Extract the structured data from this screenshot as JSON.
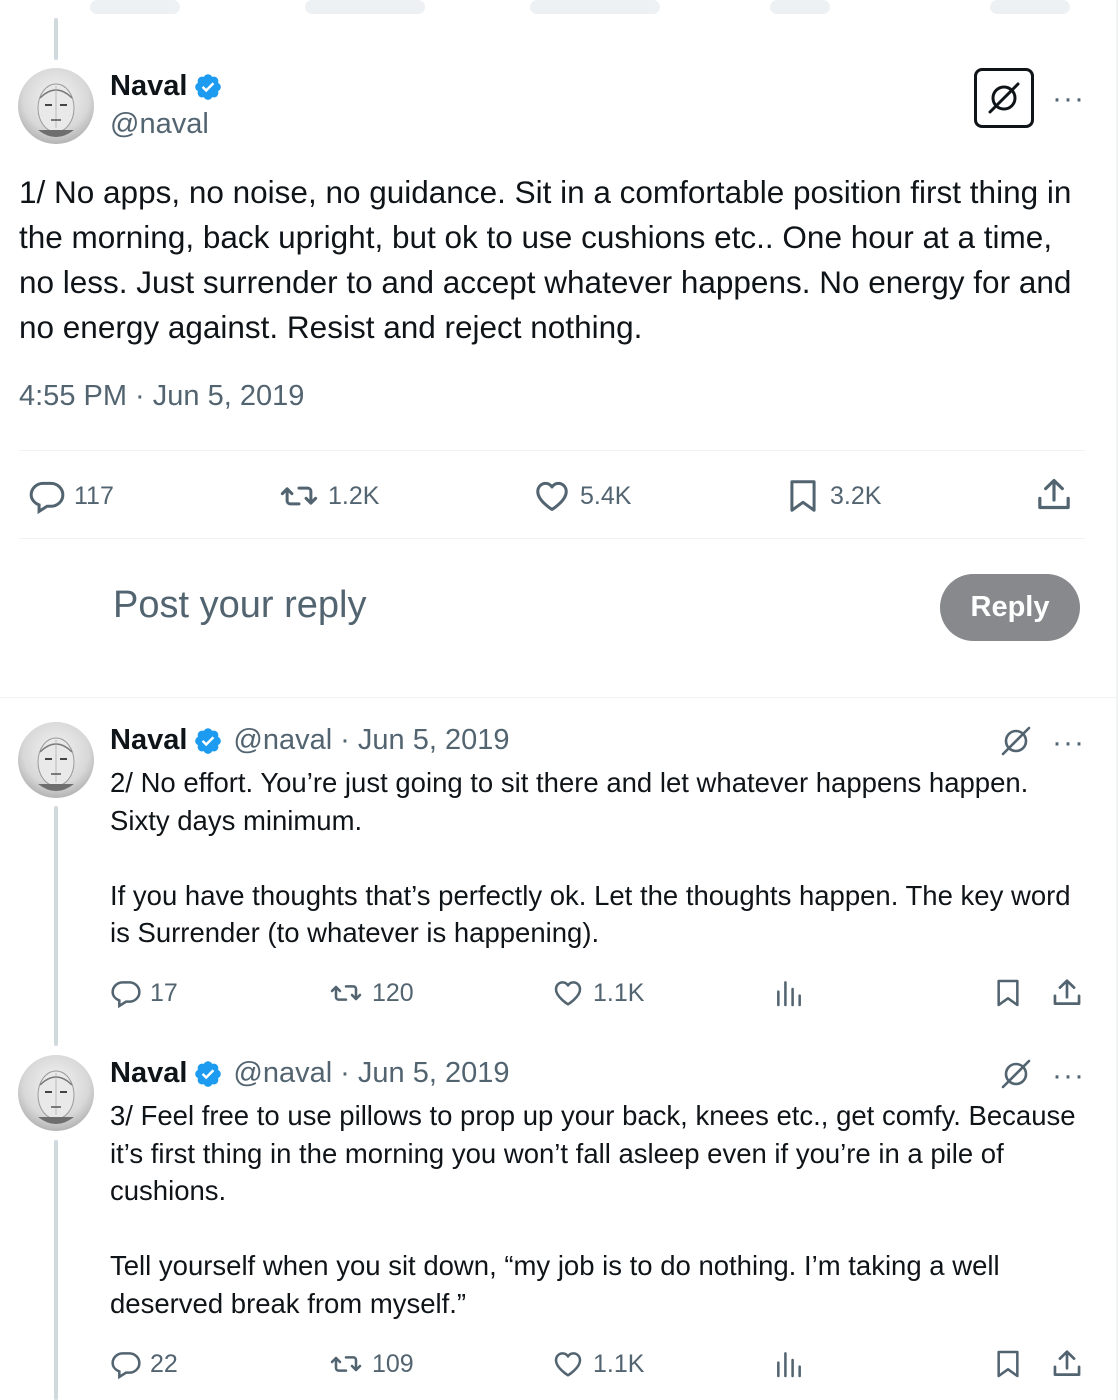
{
  "main_tweet": {
    "name": "Naval",
    "handle": "@naval",
    "text": "1/ No apps, no noise, no guidance. Sit in a comfortable position first thing in the morning, back upright, but ok to use cushions etc.. One hour at a time, no less. Just surrender to and accept whatever happens. No energy for and no energy against. Resist and reject nothing.",
    "timestamp": "4:55 PM · Jun 5, 2019",
    "replies": "117",
    "reposts": "1.2K",
    "likes": "5.4K",
    "bookmarks": "3.2K"
  },
  "composer": {
    "placeholder": "Post your reply",
    "reply_button": "Reply"
  },
  "thread": [
    {
      "name": "Naval",
      "handle": "@naval",
      "date": "· Jun 5, 2019",
      "paragraphs": [
        "2/ No effort. You’re just going to sit there and let whatever happens happen. Sixty days minimum.",
        "If you have thoughts that’s perfectly ok. Let the thoughts happen. The key word is Surrender (to whatever is happening)."
      ],
      "replies": "17",
      "reposts": "120",
      "likes": "1.1K"
    },
    {
      "name": "Naval",
      "handle": "@naval",
      "date": "· Jun 5, 2019",
      "paragraphs": [
        "3/ Feel free to use pillows to prop up your back, knees etc., get comfy. Because it’s first thing in the morning you won’t fall asleep even if you’re in a pile of cushions.",
        "Tell yourself when you sit down, “my job is to do nothing. I’m taking a well deserved break from myself.”"
      ],
      "replies": "22",
      "reposts": "109",
      "likes": "1.1K"
    }
  ],
  "icons": {
    "reply": "comment-bubble-icon",
    "repost": "repost-arrows-icon",
    "like": "heart-icon",
    "bookmark": "bookmark-icon",
    "share": "share-upload-icon",
    "views": "analytics-bars-icon",
    "grok": "grok-slash-circle-icon",
    "more": "more-dots-icon",
    "verified": "verified-badge-icon"
  },
  "colors": {
    "verified_blue": "#1d9bf0",
    "secondary_text": "#536471",
    "reply_button_bg": "#87898c",
    "divider": "#eff3f4"
  }
}
